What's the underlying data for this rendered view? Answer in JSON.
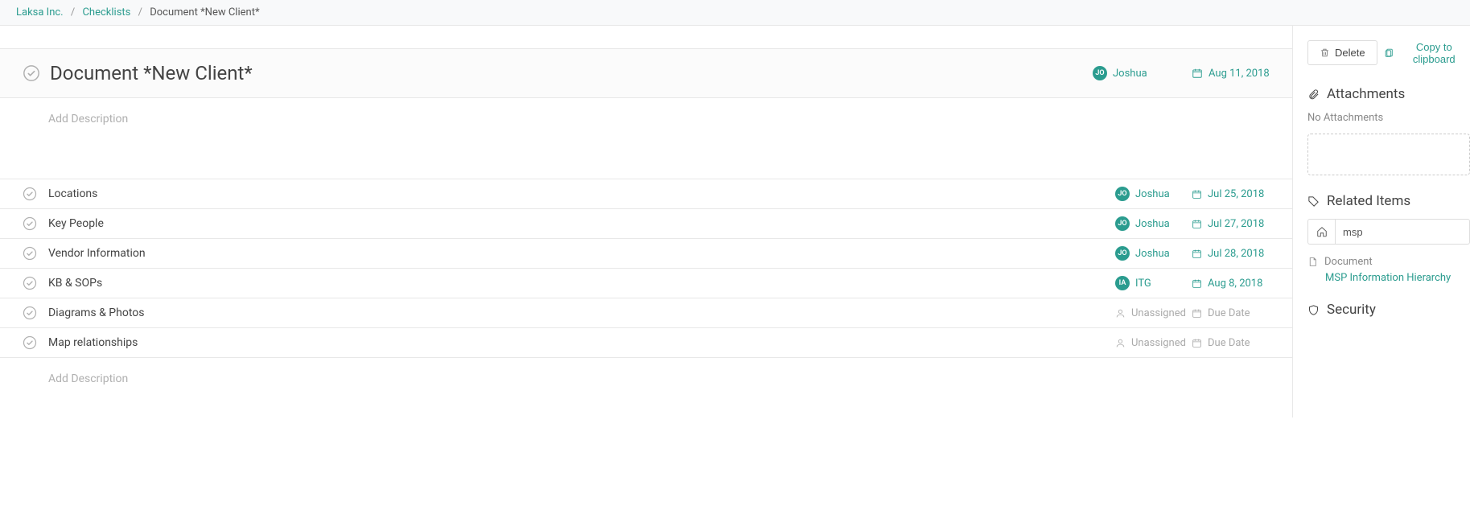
{
  "breadcrumb": {
    "org": "Laksa Inc.",
    "section": "Checklists",
    "current": "Document *New Client*"
  },
  "header": {
    "title": "Document *New Client*",
    "assignee": {
      "initials": "JO",
      "name": "Joshua"
    },
    "date": "Aug 11, 2018"
  },
  "desc_placeholder": "Add Description",
  "tasks": [
    {
      "title": "Locations",
      "assignee": {
        "initials": "JO",
        "name": "Joshua"
      },
      "date": "Jul 25, 2018"
    },
    {
      "title": "Key People",
      "assignee": {
        "initials": "JO",
        "name": "Joshua"
      },
      "date": "Jul 27, 2018"
    },
    {
      "title": "Vendor Information",
      "assignee": {
        "initials": "JO",
        "name": "Joshua"
      },
      "date": "Jul 28, 2018"
    },
    {
      "title": "KB & SOPs",
      "assignee": {
        "initials": "IA",
        "name": "ITG"
      },
      "date": "Aug 8, 2018"
    },
    {
      "title": "Diagrams & Photos",
      "assignee": null,
      "date": null
    },
    {
      "title": "Map relationships",
      "assignee": null,
      "date": null
    }
  ],
  "unassigned_label": "Unassigned",
  "due_label": "Due Date",
  "desc_bottom_placeholder": "Add Description",
  "sidebar": {
    "delete_label": "Delete",
    "copy_label": "Copy to clipboard",
    "attachments_title": "Attachments",
    "no_attachments": "No Attachments",
    "related_title": "Related Items",
    "related_input": "msp",
    "related_item": {
      "type": "Document",
      "name": "MSP Information Hierarchy"
    },
    "security_title": "Security"
  }
}
